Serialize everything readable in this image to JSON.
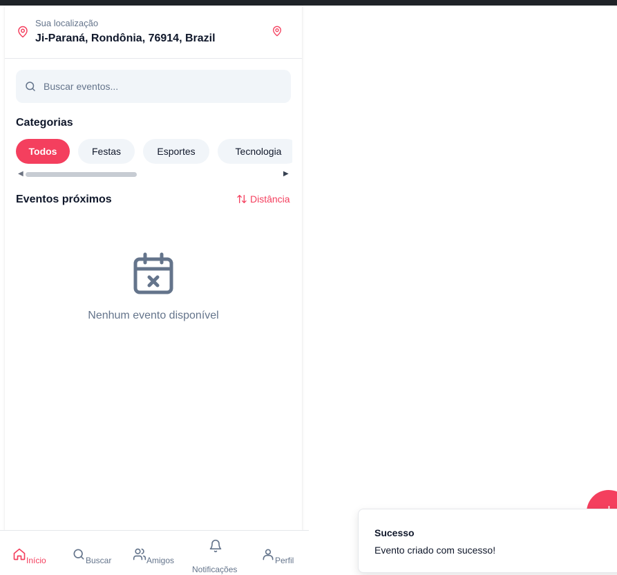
{
  "location": {
    "caption": "Sua localização",
    "value": "Ji-Paraná, Rondônia, 76914, Brazil",
    "icon": "map-pin-icon"
  },
  "search": {
    "placeholder": "Buscar eventos...",
    "value": ""
  },
  "categories": {
    "title": "Categorias",
    "items": [
      {
        "label": "Todos",
        "active": true
      },
      {
        "label": "Festas",
        "active": false
      },
      {
        "label": "Esportes",
        "active": false
      },
      {
        "label": "Tecnologia",
        "active": false
      }
    ]
  },
  "events": {
    "title": "Eventos próximos",
    "sort_label": "Distância",
    "empty_text": "Nenhum evento disponível",
    "empty_icon": "calendar-x-icon"
  },
  "bottom_nav": {
    "items": [
      {
        "label": "Início",
        "icon": "home-icon",
        "active": true
      },
      {
        "label": "Buscar",
        "icon": "search-icon",
        "active": false
      },
      {
        "label": "Amigos",
        "icon": "users-icon",
        "active": false
      },
      {
        "label": "Notificações",
        "icon": "bell-icon",
        "active": false
      },
      {
        "label": "Perfil",
        "icon": "user-icon",
        "active": false
      }
    ]
  },
  "toast": {
    "title": "Sucesso",
    "message": "Evento criado com sucesso!"
  },
  "colors": {
    "accent": "#f43f5e",
    "chip_bg": "#f1f5f9",
    "muted_text": "#64748b",
    "icon_gray": "#64748b"
  }
}
